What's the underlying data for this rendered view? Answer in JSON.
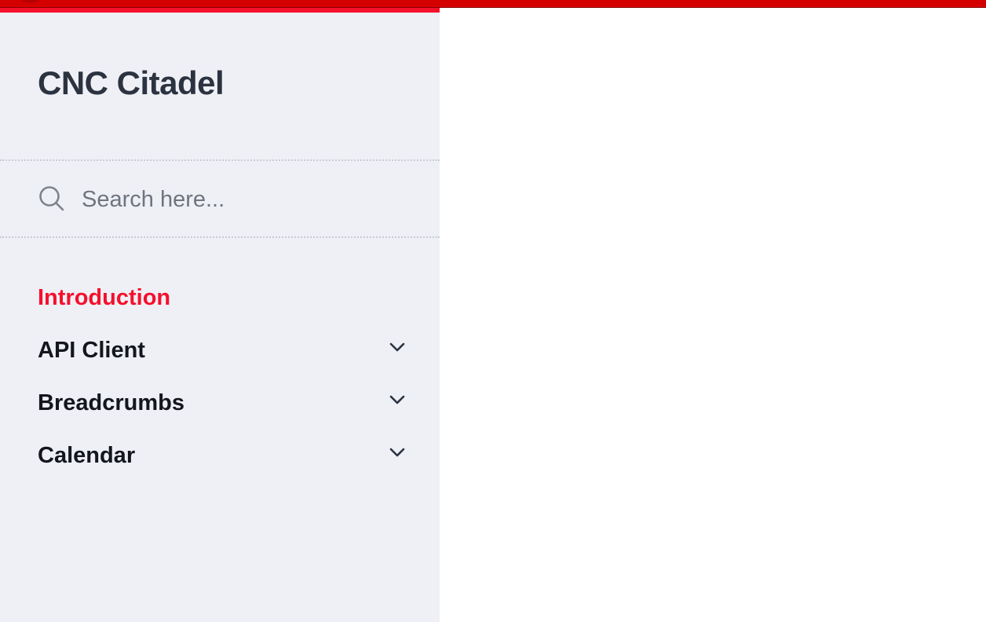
{
  "brand": {
    "title": "CNC Citadel"
  },
  "search": {
    "placeholder": "Search here...",
    "value": "",
    "icon": "search-icon"
  },
  "nav": {
    "items": [
      {
        "label": "Introduction",
        "active": true,
        "expandable": false
      },
      {
        "label": "API Client",
        "active": false,
        "expandable": true,
        "icon": "chevron-down-icon"
      },
      {
        "label": "Breadcrumbs",
        "active": false,
        "expandable": true,
        "icon": "chevron-down-icon"
      },
      {
        "label": "Calendar",
        "active": false,
        "expandable": true,
        "icon": "chevron-down-icon"
      }
    ]
  },
  "colors": {
    "accent": "#f5102c",
    "top_bar": "#d40000",
    "sidebar_bg": "#eef0f5",
    "text": "#13161c",
    "brand_text": "#2c3340",
    "muted": "#6f7580"
  }
}
